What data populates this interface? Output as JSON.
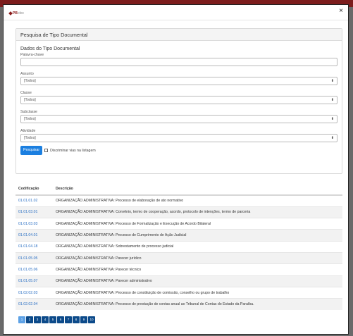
{
  "logo": {
    "brand": "PB",
    "suffix": "doc"
  },
  "close_glyph": "×",
  "card_title": "Pesquisa de Tipo Documental",
  "section_title": "Dados do Tipo Documental",
  "keyword": {
    "label": "Palavra-chave",
    "value": ""
  },
  "selects": [
    {
      "label": "Assunto",
      "value": "[Todos]"
    },
    {
      "label": "Classe",
      "value": "[Todos]"
    },
    {
      "label": "Subclasse",
      "value": "[Todos]"
    },
    {
      "label": "Atividade",
      "value": "[Todos]"
    }
  ],
  "search_button": "Pesquisar",
  "discriminate_label": "Discriminar vias na listagem",
  "table": {
    "headers": [
      "Codificação",
      "Descrição"
    ],
    "rows": [
      [
        "01.01.01.02",
        "ORGANIZAÇÃO ADMINISTRATIVA: Processo de elaboração de ato normativo"
      ],
      [
        "01.01.03.01",
        "ORGANIZAÇÃO ADMINISTRATIVA: Convênio, termo de cooperação, acordo, protocolo de intenções, termo de parceria"
      ],
      [
        "01.01.03.03",
        "ORGANIZAÇÃO ADMINISTRATIVA: Processo de Formalização e Execução de Acordo Bilateral"
      ],
      [
        "01.01.04.01",
        "ORGANIZAÇÃO ADMINISTRATIVA: Processo de Cumprimento de Ação Judicial"
      ],
      [
        "01.01.04.18",
        "ORGANIZAÇÃO ADMINISTRATIVA: Sobrestamento de processo judicial"
      ],
      [
        "01.01.05.05",
        "ORGANIZAÇÃO ADMINISTRATIVA: Parecer jurídico"
      ],
      [
        "01.01.05.06",
        "ORGANIZAÇÃO ADMINISTRATIVA: Parecer técnico"
      ],
      [
        "01.01.05.07",
        "ORGANIZAÇÃO ADMINISTRATIVA: Parecer administrativo"
      ],
      [
        "01.02.02.03",
        "ORGANIZAÇÃO ADMINISTRATIVA: Processo de constituição de comissão, conselho ou grupo de trabalho"
      ],
      [
        "01.02.02.04",
        "ORGANIZAÇÃO ADMINISTRATIVA: Processo de prestação de contas anual ao Tribunal de Contas do Estado da Paraíba."
      ]
    ]
  },
  "pagination": {
    "pages": [
      "1",
      "2",
      "3",
      "4",
      "5",
      "6",
      "7",
      "8",
      "9",
      "10"
    ],
    "current": "1"
  },
  "colors": {
    "primary": "#1b7fe0",
    "link": "#2a6fc4",
    "pager": "#0c4a8a",
    "pager_active": "#5ea2e6"
  }
}
